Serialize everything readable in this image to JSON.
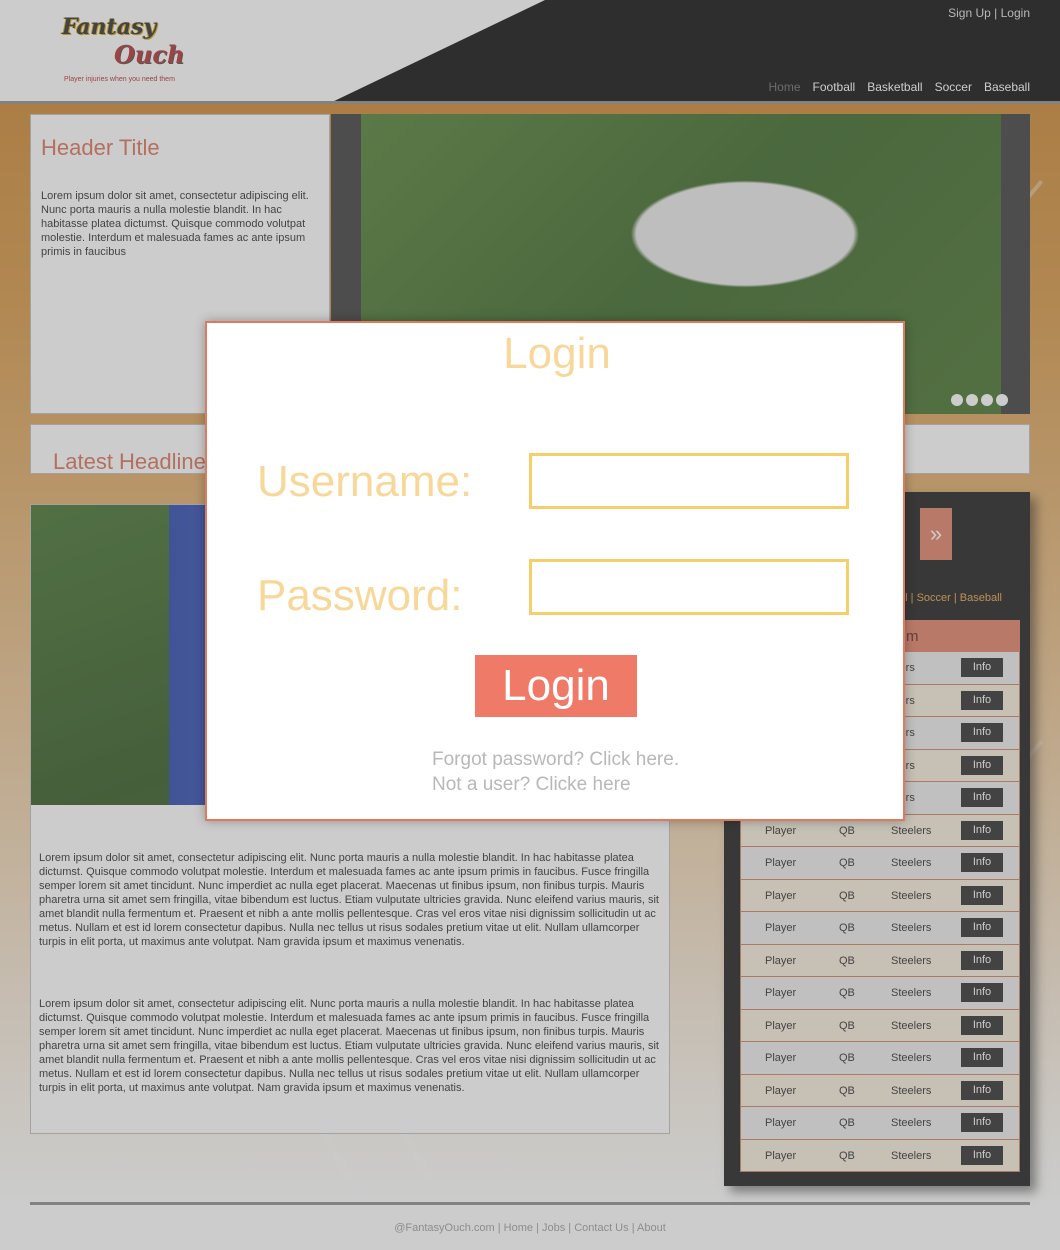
{
  "header": {
    "logo": {
      "line1": "Fantasy",
      "line2": "Ouch",
      "tagline": "Player injuries when you need them"
    },
    "auth": {
      "signup": "Sign Up",
      "separator": "|",
      "login": "Login"
    },
    "nav": [
      "Home",
      "Football",
      "Basketball",
      "Soccer",
      "Baseball"
    ]
  },
  "title_box": {
    "title": "Header Title",
    "text": "Lorem ipsum dolor sit amet, consectetur adipiscing elit. Nunc porta mauris a nulla molestie blandit. In hac habitasse platea dictumst. Quisque commodo volutpat molestie. Interdum et malesuada fames ac ante ipsum primis in faucibus"
  },
  "headline": {
    "title": "Latest Headline"
  },
  "article": {
    "p1": "Lorem ipsum dolor sit amet, consectetur adipiscing elit. Nunc porta mauris a nulla molestie blandit. In hac habitasse platea dictumst. Quisque commodo volutpat molestie. Interdum et malesuada fames ac ante ipsum primis in faucibus. Fusce fringilla semper lorem sit amet tincidunt. Nunc imperdiet ac nulla eget placerat. Maecenas ut finibus ipsum, non finibus turpis. Mauris pharetra urna sit amet sem fringilla, vitae bibendum est luctus. Etiam vulputate ultricies gravida. Nunc eleifend varius mauris, sit amet blandit nulla fermentum et. Praesent et nibh a ante mollis pellentesque. Cras vel eros vitae nisi dignissim sollicitudin ut ac metus. Nullam et est id lorem consectetur dapibus. Nulla nec tellus ut risus sodales pretium vitae ut elit. Nullam ullamcorper turpis in elit porta, ut maximus ante volutpat. Nam gravida ipsum et maximus venenatis.",
    "p2": "Lorem ipsum dolor sit amet, consectetur adipiscing elit. Nunc porta mauris a nulla molestie blandit. In hac habitasse platea dictumst. Quisque commodo volutpat molestie. Interdum et malesuada fames ac ante ipsum primis in faucibus. Fusce fringilla semper lorem sit amet tincidunt. Nunc imperdiet ac nulla eget placerat. Maecenas ut finibus ipsum, non finibus turpis. Mauris pharetra urna sit amet sem fringilla, vitae bibendum est luctus. Etiam vulputate ultricies gravida. Nunc eleifend varius mauris, sit amet blandit nulla fermentum et. Praesent et nibh a ante mollis pellentesque. Cras vel eros vitae nisi dignissim sollicitudin ut ac metus. Nullam et est id lorem consectetur dapibus. Nulla nec tellus ut risus sodales pretium vitae ut elit. Nullam ullamcorper turpis in elit porta, ut maximus ante volutpat. Nam gravida ipsum et maximus venenatis."
  },
  "sidebar": {
    "arrow": "»",
    "categories": "ll | Soccer | Baseball",
    "header_fragment": "m",
    "rows": [
      {
        "player": "",
        "pos": "",
        "team": "elers",
        "action": "Info"
      },
      {
        "player": "",
        "pos": "",
        "team": "elers",
        "action": "Info"
      },
      {
        "player": "",
        "pos": "",
        "team": "elers",
        "action": "Info"
      },
      {
        "player": "",
        "pos": "",
        "team": "elers",
        "action": "Info"
      },
      {
        "player": "",
        "pos": "",
        "team": "elers",
        "action": "Info"
      },
      {
        "player": "Player",
        "pos": "QB",
        "team": "Steelers",
        "action": "Info"
      },
      {
        "player": "Player",
        "pos": "QB",
        "team": "Steelers",
        "action": "Info"
      },
      {
        "player": "Player",
        "pos": "QB",
        "team": "Steelers",
        "action": "Info"
      },
      {
        "player": "Player",
        "pos": "QB",
        "team": "Steelers",
        "action": "Info"
      },
      {
        "player": "Player",
        "pos": "QB",
        "team": "Steelers",
        "action": "Info"
      },
      {
        "player": "Player",
        "pos": "QB",
        "team": "Steelers",
        "action": "Info"
      },
      {
        "player": "Player",
        "pos": "QB",
        "team": "Steelers",
        "action": "Info"
      },
      {
        "player": "Player",
        "pos": "QB",
        "team": "Steelers",
        "action": "Info"
      },
      {
        "player": "Player",
        "pos": "QB",
        "team": "Steelers",
        "action": "Info"
      },
      {
        "player": "Player",
        "pos": "QB",
        "team": "Steelers",
        "action": "Info"
      },
      {
        "player": "Player",
        "pos": "QB",
        "team": "Steelers",
        "action": "Info"
      }
    ]
  },
  "footer": {
    "items": [
      "@FantasyOuch.com",
      "Home",
      "Jobs",
      "Contact Us",
      "About"
    ],
    "separator": " | "
  },
  "modal": {
    "title": "Login",
    "username_label": "Username:",
    "password_label": "Password:",
    "username_value": "",
    "password_value": "",
    "button": "Login",
    "forgot": "Forgot password? Click here.",
    "register": "Not a user? Clicke here"
  },
  "colors": {
    "accent": "#e07a5f",
    "modal_text": "#f8d89a",
    "field_border": "#f5d06a",
    "background_orange": "#c77a1e"
  }
}
